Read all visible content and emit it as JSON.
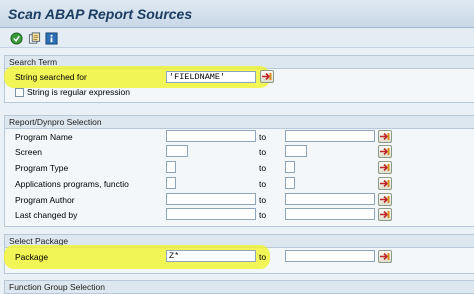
{
  "window": {
    "title": "Scan ABAP Report Sources"
  },
  "toolbar": {
    "icons": [
      "execute-icon",
      "variant-icon",
      "info-icon"
    ]
  },
  "search_term": {
    "header": "Search Term",
    "string_label": "String searched for",
    "string_value": "'FIELDNAME'",
    "regex_label": "String is regular expression"
  },
  "report_selection": {
    "header": "Report/Dynpro Selection",
    "to_label": "to",
    "rows": [
      {
        "label": "Program Name"
      },
      {
        "label": "Screen"
      },
      {
        "label": "Program Type"
      },
      {
        "label": "Applications programs, functio"
      },
      {
        "label": "Program Author"
      },
      {
        "label": "Last changed by"
      }
    ]
  },
  "select_package": {
    "header": "Select Package",
    "package_label": "Package",
    "package_value": "Z*",
    "to_label": "to"
  },
  "function_group": {
    "header": "Function Group Selection"
  },
  "colors": {
    "highlight": "#f0f528",
    "title": "#1b3c63",
    "group_header": "#dde7ef"
  }
}
